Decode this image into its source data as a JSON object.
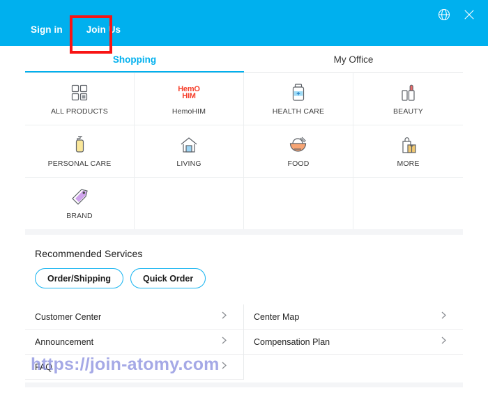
{
  "topbar": {
    "sign_in": "Sign in",
    "join_us": "Join Us",
    "globe_icon": "globe-icon",
    "close_icon": "close-icon",
    "background_color": "#00b0ee"
  },
  "tabs": [
    {
      "label": "Shopping",
      "active": true
    },
    {
      "label": "My Office",
      "active": false
    }
  ],
  "categories": [
    {
      "label": "ALL PRODUCTS",
      "icon": "grid-squares-icon"
    },
    {
      "label": "HemoHIM",
      "icon": "hemohim-logo",
      "logo_line1": "HemO",
      "logo_line2": "HIM"
    },
    {
      "label": "HEALTH CARE",
      "icon": "pill-bottle-icon"
    },
    {
      "label": "BEAUTY",
      "icon": "lipstick-icon"
    },
    {
      "label": "PERSONAL CARE",
      "icon": "pump-bottle-icon"
    },
    {
      "label": "LIVING",
      "icon": "house-icon"
    },
    {
      "label": "FOOD",
      "icon": "noodle-bowl-icon"
    },
    {
      "label": "MORE",
      "icon": "shopping-bag-box-icon"
    },
    {
      "label": "BRAND",
      "icon": "price-tag-icon"
    }
  ],
  "recommended": {
    "title": "Recommended Services",
    "chips": [
      {
        "label": "Order/Shipping"
      },
      {
        "label": "Quick Order"
      }
    ]
  },
  "links": {
    "left": [
      {
        "label": "Customer Center"
      },
      {
        "label": "Announcement"
      },
      {
        "label": "FAQ"
      }
    ],
    "right": [
      {
        "label": "Center Map"
      },
      {
        "label": "Compensation Plan"
      }
    ]
  },
  "watermark": {
    "text": "https://join-atomy.com",
    "color": "#8d91e0"
  },
  "annotation": {
    "target": "Join Us",
    "box_color": "#f81414"
  }
}
